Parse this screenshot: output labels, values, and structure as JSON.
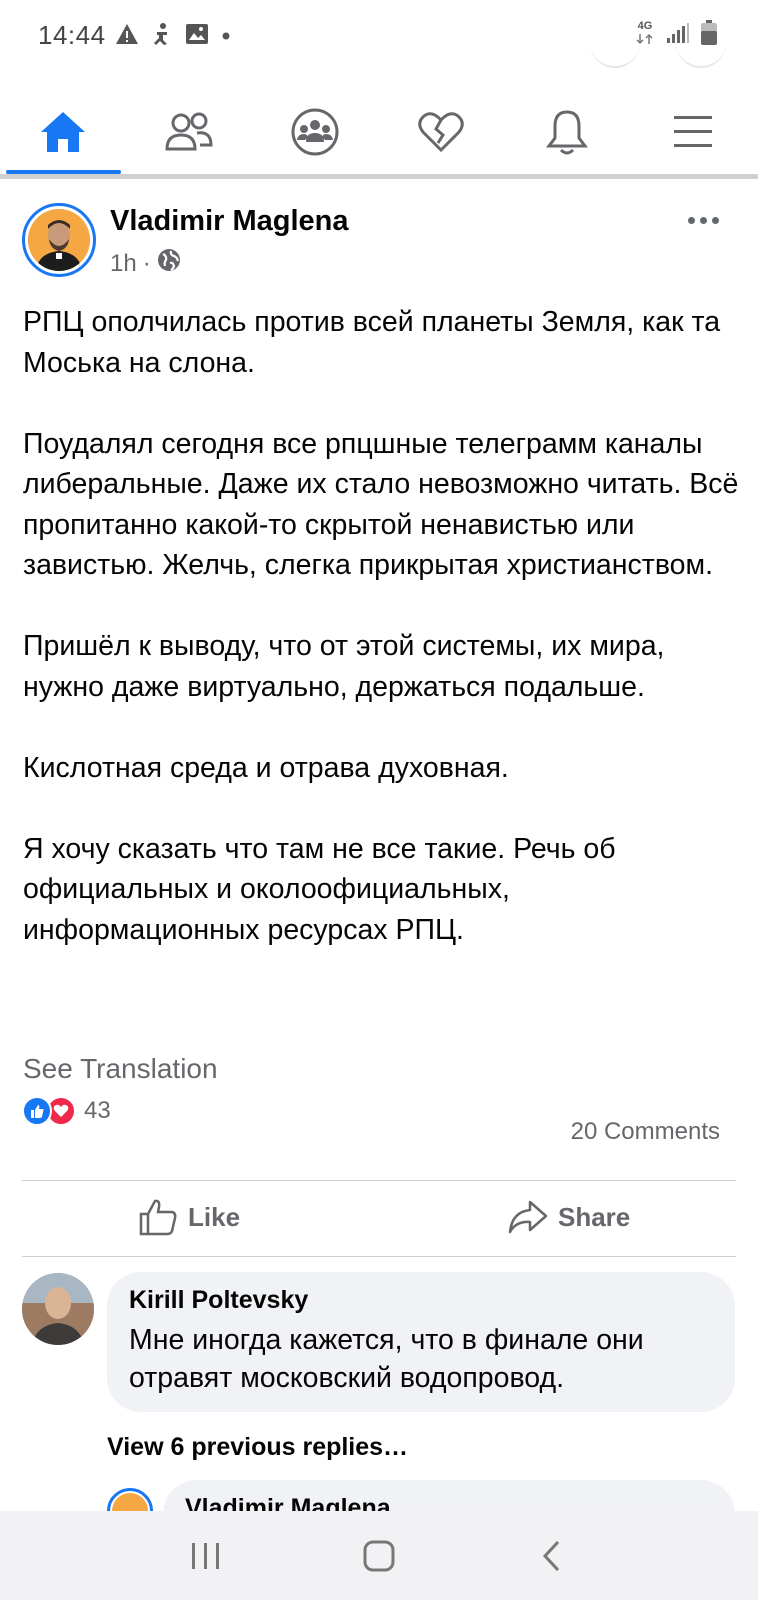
{
  "status_bar": {
    "time": "14:44",
    "network": "4G",
    "icons_left": [
      "warning-icon",
      "accessibility-icon",
      "gallery-icon",
      "dot-icon"
    ],
    "icons_right": [
      "network-4g-icon",
      "signal-icon",
      "battery-icon"
    ]
  },
  "nav": {
    "items": [
      {
        "name": "home",
        "icon": "home-icon",
        "active": true
      },
      {
        "name": "friends",
        "icon": "friends-icon",
        "active": false
      },
      {
        "name": "groups",
        "icon": "groups-icon",
        "active": false
      },
      {
        "name": "dating",
        "icon": "heart-icon",
        "active": false
      },
      {
        "name": "notifications",
        "icon": "bell-icon",
        "active": false
      },
      {
        "name": "menu",
        "icon": "menu-icon",
        "active": false
      }
    ],
    "accent_color": "#1877f2"
  },
  "post": {
    "author": "Vladimir Maglena",
    "time": "1h",
    "separator": "·",
    "privacy_icon": "globe-icon",
    "paragraphs": [
      "РПЦ ополчилась против всей планеты Земля, как та Моська на слона.",
      "Поудалял сегодня все рпцшные телеграмм каналы либеральные. Даже их стало невозможно читать. Всё пропитанно какой-то скрытой ненавистью или завистью. Желчь, слегка прикрытая христианством.",
      "Пришёл к выводу, что от этой системы, их мира,  нужно даже виртуально, держаться подальше.",
      "Кислотная среда и отрава духовная.",
      "Я хочу сказать что там не все такие. Речь об официальных и околоофициальных, информационных ресурсах РПЦ."
    ],
    "see_translation": "See Translation",
    "reaction_count": "43",
    "comments_count": "20 Comments",
    "like_label": "Like",
    "share_label": "Share"
  },
  "comment": {
    "author": "Kirill Poltevsky",
    "text": "Мне иногда кажется, что в финале они отравят московский водопровод."
  },
  "view_replies": "View 6 previous replies…",
  "reply": {
    "author": "Vladimir Maglena"
  }
}
